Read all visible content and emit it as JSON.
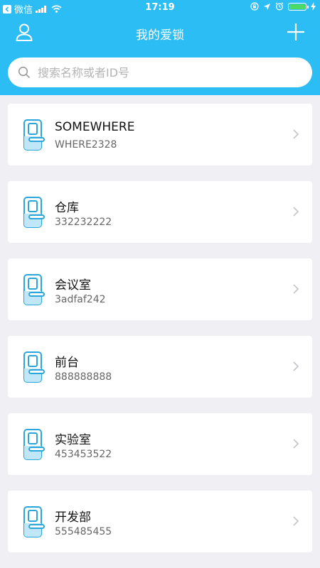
{
  "status_bar": {
    "back_app": "微信",
    "time": "17:19"
  },
  "nav": {
    "title": "我的爱锁",
    "user_icon": "user-icon",
    "add_icon": "plus-icon"
  },
  "search": {
    "placeholder": "搜索名称或者ID号",
    "value": ""
  },
  "colors": {
    "header_bg": "#2bbdf3",
    "page_bg": "#efeff4",
    "icon_blue": "#2aa6dc"
  },
  "locks": [
    {
      "name": "SOMEWHERE",
      "id": "WHERE2328"
    },
    {
      "name": "仓库",
      "id": "332232222"
    },
    {
      "name": "会议室",
      "id": "3adfaf242"
    },
    {
      "name": "前台",
      "id": "888888888"
    },
    {
      "name": "实验室",
      "id": "453453522"
    },
    {
      "name": "开发部",
      "id": "555485455"
    }
  ]
}
